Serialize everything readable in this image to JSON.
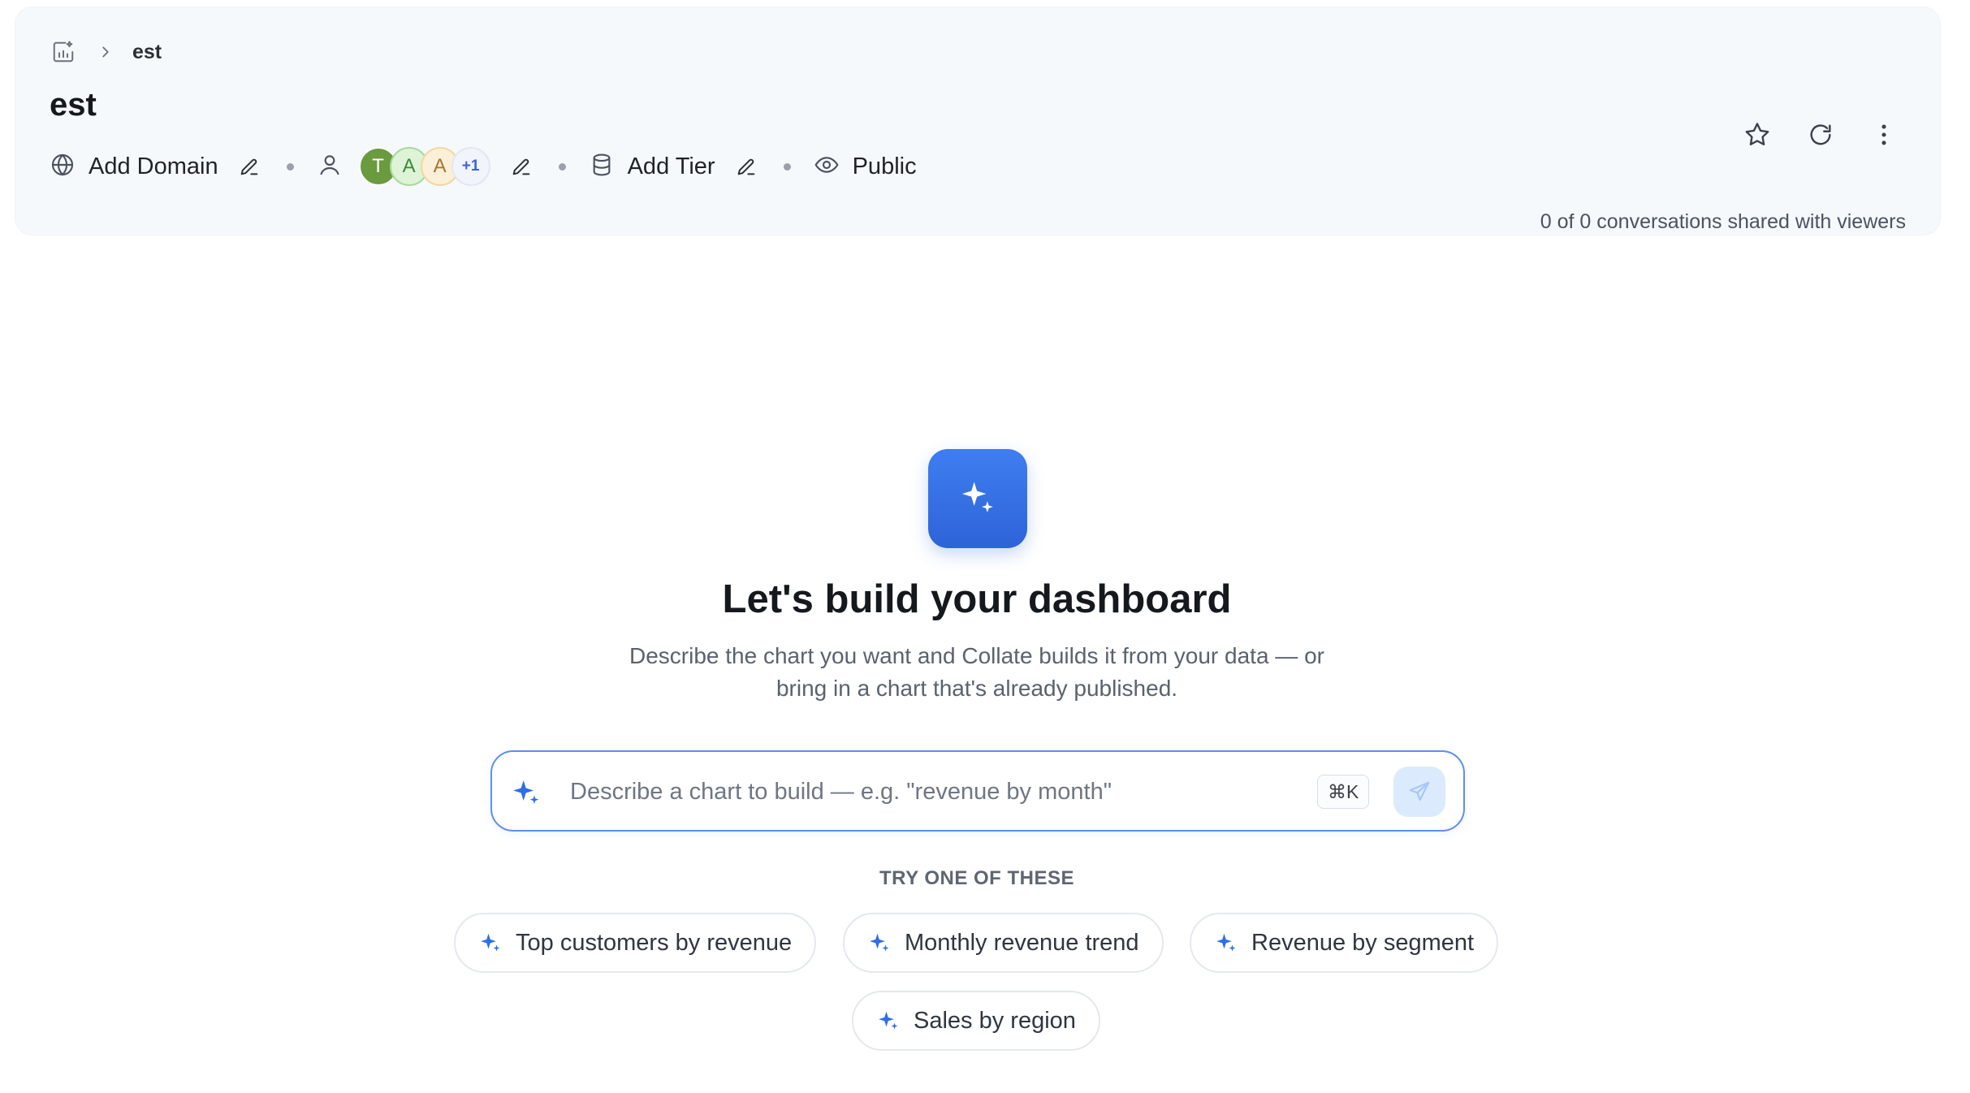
{
  "breadcrumb": {
    "current": "est"
  },
  "page": {
    "title": "est"
  },
  "meta": {
    "domain_label": "Add Domain",
    "owners": [
      {
        "initial": "T"
      },
      {
        "initial": "A"
      },
      {
        "initial": "A"
      }
    ],
    "owners_more": "+1",
    "tier_label": "Add Tier",
    "visibility_label": "Public"
  },
  "share_status": "0 of 0 conversations shared with viewers",
  "hero": {
    "title": "Let's build your dashboard",
    "subtitle_line1": "Describe the chart you want and Collate builds it from your data — or",
    "subtitle_line2": "bring in a chart that's already published."
  },
  "prompt": {
    "placeholder": "Describe a chart to build — e.g. \"revenue by month\"",
    "value": "",
    "shortcut": "⌘K"
  },
  "suggestions": {
    "label": "TRY ONE OF THESE",
    "items": [
      {
        "label": "Top customers by revenue"
      },
      {
        "label": "Monthly revenue trend"
      },
      {
        "label": "Revenue by segment"
      },
      {
        "label": "Sales by region"
      }
    ]
  },
  "colors": {
    "accent": "#2d64d8",
    "header_bg": "#f6f9fc",
    "prompt_border": "#5d8ff0"
  }
}
